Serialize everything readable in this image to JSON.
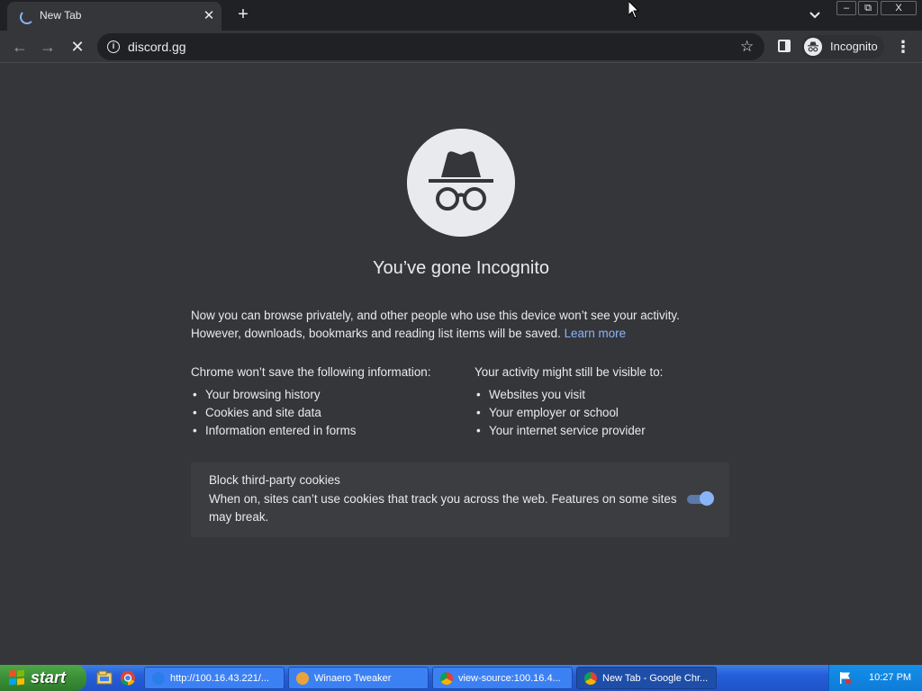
{
  "browser": {
    "tab_title": "New Tab",
    "tab_close": "✕",
    "new_tab": "+",
    "url": "discord.gg",
    "profile_label": "Incognito",
    "window_min": "–",
    "window_max": "⧉",
    "window_close": "X",
    "nav_back": "←",
    "nav_forward": "→",
    "nav_stop": "✕",
    "menu": "⋮",
    "bookmark": "☆"
  },
  "page": {
    "headline": "You’ve gone Incognito",
    "intro_text": "Now you can browse privately, and other people who use this device won’t see your activity. However, downloads, bookmarks and reading list items will be saved.",
    "learn_more": "Learn more",
    "left_column": {
      "heading": "Chrome won’t save the following information:",
      "items": [
        "Your browsing history",
        "Cookies and site data",
        "Information entered in forms"
      ]
    },
    "right_column": {
      "heading": "Your activity might still be visible to:",
      "items": [
        "Websites you visit",
        "Your employer or school",
        "Your internet service provider"
      ]
    },
    "cookies_card": {
      "title": "Block third-party cookies",
      "description": "When on, sites can’t use cookies that track you across the web. Features on some sites may break.",
      "toggle_on": true
    }
  },
  "taskbar": {
    "start_label": "start",
    "tasks": [
      {
        "label": "http://100.16.43.221/...",
        "icon": "ie-icon"
      },
      {
        "label": "Winaero Tweaker",
        "icon": "winaero-icon"
      },
      {
        "label": "view-source:100.16.4...",
        "icon": "chrome-icon"
      },
      {
        "label": "New Tab - Google Chr...",
        "icon": "chrome-icon"
      }
    ],
    "clock": "10:27 PM"
  },
  "colors": {
    "page_bg": "#35363a",
    "link": "#8ab4f8",
    "toggle_on": "#8ab4f8"
  }
}
